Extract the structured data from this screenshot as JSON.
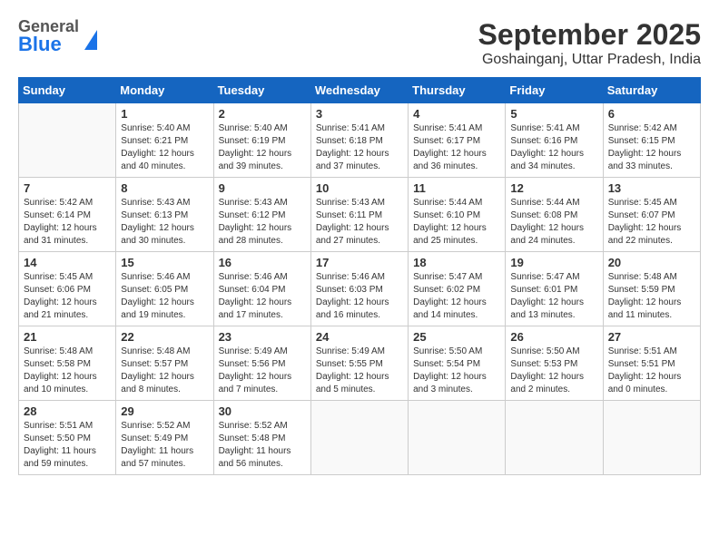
{
  "header": {
    "logo_general": "General",
    "logo_blue": "Blue",
    "month": "September 2025",
    "location": "Goshainganj, Uttar Pradesh, India"
  },
  "weekdays": [
    "Sunday",
    "Monday",
    "Tuesday",
    "Wednesday",
    "Thursday",
    "Friday",
    "Saturday"
  ],
  "weeks": [
    [
      {
        "day": "",
        "info": ""
      },
      {
        "day": "1",
        "info": "Sunrise: 5:40 AM\nSunset: 6:21 PM\nDaylight: 12 hours\nand 40 minutes."
      },
      {
        "day": "2",
        "info": "Sunrise: 5:40 AM\nSunset: 6:19 PM\nDaylight: 12 hours\nand 39 minutes."
      },
      {
        "day": "3",
        "info": "Sunrise: 5:41 AM\nSunset: 6:18 PM\nDaylight: 12 hours\nand 37 minutes."
      },
      {
        "day": "4",
        "info": "Sunrise: 5:41 AM\nSunset: 6:17 PM\nDaylight: 12 hours\nand 36 minutes."
      },
      {
        "day": "5",
        "info": "Sunrise: 5:41 AM\nSunset: 6:16 PM\nDaylight: 12 hours\nand 34 minutes."
      },
      {
        "day": "6",
        "info": "Sunrise: 5:42 AM\nSunset: 6:15 PM\nDaylight: 12 hours\nand 33 minutes."
      }
    ],
    [
      {
        "day": "7",
        "info": "Sunrise: 5:42 AM\nSunset: 6:14 PM\nDaylight: 12 hours\nand 31 minutes."
      },
      {
        "day": "8",
        "info": "Sunrise: 5:43 AM\nSunset: 6:13 PM\nDaylight: 12 hours\nand 30 minutes."
      },
      {
        "day": "9",
        "info": "Sunrise: 5:43 AM\nSunset: 6:12 PM\nDaylight: 12 hours\nand 28 minutes."
      },
      {
        "day": "10",
        "info": "Sunrise: 5:43 AM\nSunset: 6:11 PM\nDaylight: 12 hours\nand 27 minutes."
      },
      {
        "day": "11",
        "info": "Sunrise: 5:44 AM\nSunset: 6:10 PM\nDaylight: 12 hours\nand 25 minutes."
      },
      {
        "day": "12",
        "info": "Sunrise: 5:44 AM\nSunset: 6:08 PM\nDaylight: 12 hours\nand 24 minutes."
      },
      {
        "day": "13",
        "info": "Sunrise: 5:45 AM\nSunset: 6:07 PM\nDaylight: 12 hours\nand 22 minutes."
      }
    ],
    [
      {
        "day": "14",
        "info": "Sunrise: 5:45 AM\nSunset: 6:06 PM\nDaylight: 12 hours\nand 21 minutes."
      },
      {
        "day": "15",
        "info": "Sunrise: 5:46 AM\nSunset: 6:05 PM\nDaylight: 12 hours\nand 19 minutes."
      },
      {
        "day": "16",
        "info": "Sunrise: 5:46 AM\nSunset: 6:04 PM\nDaylight: 12 hours\nand 17 minutes."
      },
      {
        "day": "17",
        "info": "Sunrise: 5:46 AM\nSunset: 6:03 PM\nDaylight: 12 hours\nand 16 minutes."
      },
      {
        "day": "18",
        "info": "Sunrise: 5:47 AM\nSunset: 6:02 PM\nDaylight: 12 hours\nand 14 minutes."
      },
      {
        "day": "19",
        "info": "Sunrise: 5:47 AM\nSunset: 6:01 PM\nDaylight: 12 hours\nand 13 minutes."
      },
      {
        "day": "20",
        "info": "Sunrise: 5:48 AM\nSunset: 5:59 PM\nDaylight: 12 hours\nand 11 minutes."
      }
    ],
    [
      {
        "day": "21",
        "info": "Sunrise: 5:48 AM\nSunset: 5:58 PM\nDaylight: 12 hours\nand 10 minutes."
      },
      {
        "day": "22",
        "info": "Sunrise: 5:48 AM\nSunset: 5:57 PM\nDaylight: 12 hours\nand 8 minutes."
      },
      {
        "day": "23",
        "info": "Sunrise: 5:49 AM\nSunset: 5:56 PM\nDaylight: 12 hours\nand 7 minutes."
      },
      {
        "day": "24",
        "info": "Sunrise: 5:49 AM\nSunset: 5:55 PM\nDaylight: 12 hours\nand 5 minutes."
      },
      {
        "day": "25",
        "info": "Sunrise: 5:50 AM\nSunset: 5:54 PM\nDaylight: 12 hours\nand 3 minutes."
      },
      {
        "day": "26",
        "info": "Sunrise: 5:50 AM\nSunset: 5:53 PM\nDaylight: 12 hours\nand 2 minutes."
      },
      {
        "day": "27",
        "info": "Sunrise: 5:51 AM\nSunset: 5:51 PM\nDaylight: 12 hours\nand 0 minutes."
      }
    ],
    [
      {
        "day": "28",
        "info": "Sunrise: 5:51 AM\nSunset: 5:50 PM\nDaylight: 11 hours\nand 59 minutes."
      },
      {
        "day": "29",
        "info": "Sunrise: 5:52 AM\nSunset: 5:49 PM\nDaylight: 11 hours\nand 57 minutes."
      },
      {
        "day": "30",
        "info": "Sunrise: 5:52 AM\nSunset: 5:48 PM\nDaylight: 11 hours\nand 56 minutes."
      },
      {
        "day": "",
        "info": ""
      },
      {
        "day": "",
        "info": ""
      },
      {
        "day": "",
        "info": ""
      },
      {
        "day": "",
        "info": ""
      }
    ]
  ]
}
